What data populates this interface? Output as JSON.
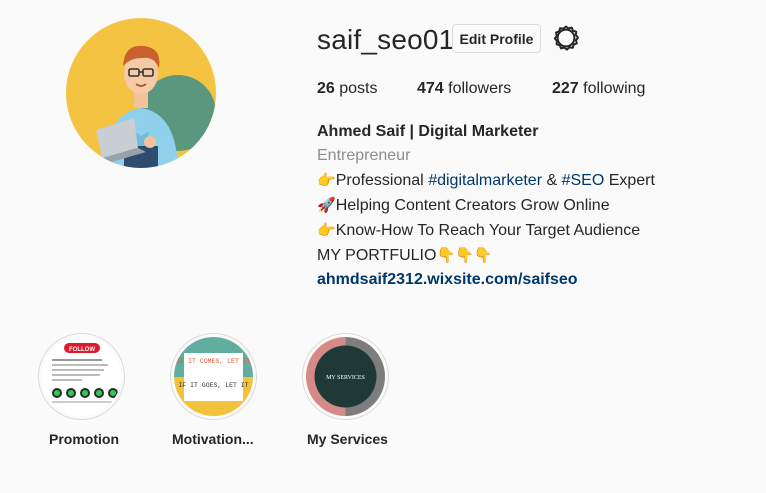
{
  "profile": {
    "username": "saif_seo01",
    "edit_label": "Edit Profile",
    "stats": {
      "posts_count": "26",
      "posts_label": "posts",
      "followers_count": "474",
      "followers_label": "followers",
      "following_count": "227",
      "following_label": "following"
    },
    "bio": {
      "name": "Ahmed Saif | Digital Marketer",
      "category": "Entrepreneur",
      "line1_emoji": "👉",
      "line1_pre": "Professional ",
      "line1_tag1": "#digitalmarketer",
      "line1_mid": " & ",
      "line1_tag2": "#SEO",
      "line1_post": " Expert",
      "line2_emoji": "🚀",
      "line2_text": "Helping Content Creators Grow Online",
      "line3_emoji": "👉",
      "line3_text": "Know-How To Reach Your Target Audience",
      "line4_text": "MY PORTFULIO",
      "line4_emoji": "👇👇👇",
      "link": "ahmdsaif2312.wixsite.com/saifseo"
    }
  },
  "highlights": [
    {
      "label": "Promotion",
      "cover_badge": "FOLLOW"
    },
    {
      "label": "Motivation...",
      "cover_text_1": "IF IT COMES, LET IT",
      "cover_text_2": "IF IT GOES, LET IT"
    },
    {
      "label": "My Services",
      "cover_text": "MY SERVICES"
    }
  ],
  "colors": {
    "text": "#262626",
    "muted": "#8e8e8e",
    "link": "#00376b",
    "border": "#dbdbdb",
    "background": "#fafafa",
    "avatar_bg": "#f5c342"
  },
  "icons": {
    "settings": "gear-icon"
  }
}
